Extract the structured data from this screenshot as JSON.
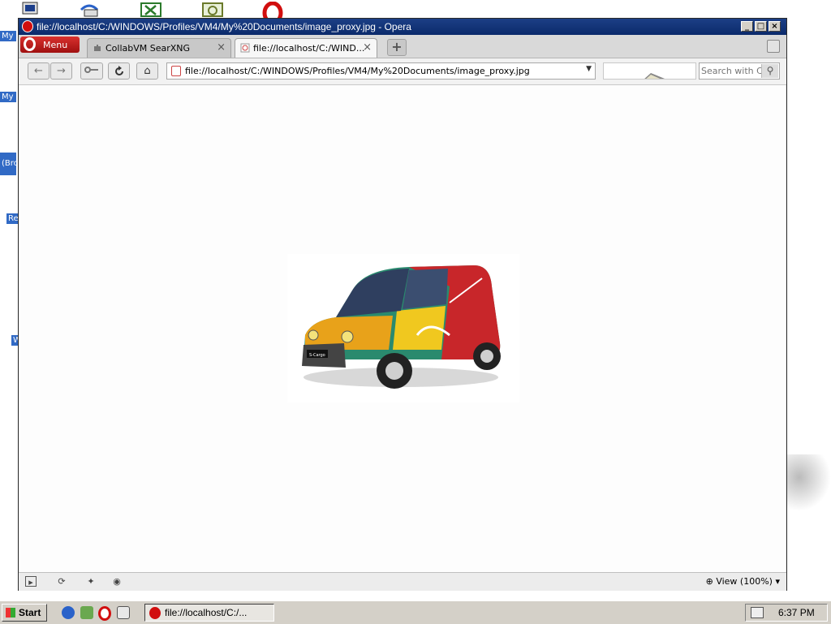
{
  "desktop": {
    "icons": [
      "my-computer-icon",
      "network-icon",
      "spreadsheet-icon",
      "clock-icon",
      "opera-icon"
    ],
    "labels": [
      "My",
      "My I",
      "(Bro",
      "Re",
      "W"
    ]
  },
  "window": {
    "title": "file://localhost/C:/WINDOWS/Profiles/VM4/My%20Documents/image_proxy.jpg - Opera",
    "minimize": "_",
    "maximize": "□",
    "close": "×"
  },
  "menu": {
    "label": "Menu"
  },
  "tabs": [
    {
      "label": "CollabVM SearXNG",
      "close": "×",
      "active": false
    },
    {
      "label": "file://localhost/C:/WIND...",
      "close": "×",
      "active": true
    }
  ],
  "new_tab": "+",
  "nav": {
    "back": "←",
    "forward": "→",
    "home": "⌂",
    "address": "file://localhost/C:/WINDOWS/Profiles/VM4/My%20Documents/image_proxy.jpg",
    "address_dropdown": "▼",
    "search_placeholder": "Search with Co",
    "search_button": "⚲"
  },
  "image": {
    "badge": "S-Cargo"
  },
  "statusbar": {
    "zoom": "View (100%)"
  },
  "taskbar": {
    "start": "Start",
    "task_label": "file://localhost/C:/...",
    "clock": "6:37 PM"
  }
}
